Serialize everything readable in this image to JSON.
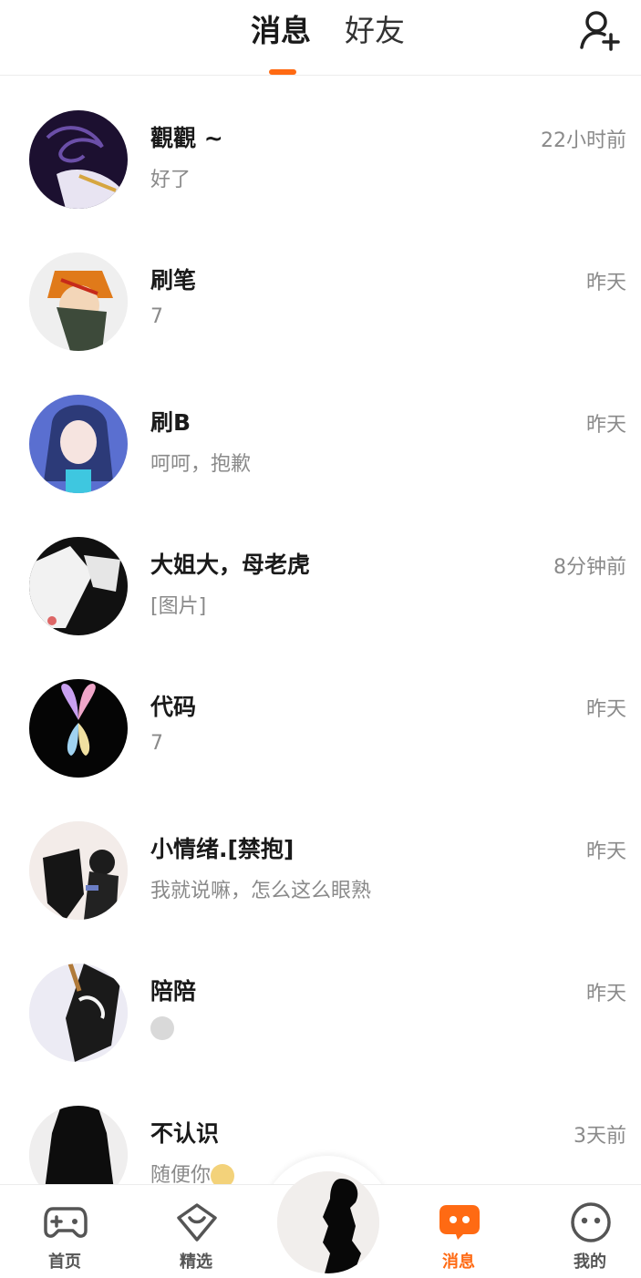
{
  "header": {
    "tabs": [
      {
        "label": "消息",
        "active": true
      },
      {
        "label": "好友",
        "active": false
      }
    ],
    "add_friend_icon": "add-user-icon",
    "accent_color": "#ff6a13"
  },
  "conversations": [
    {
      "name": "觀觀 ~",
      "preview": "好了",
      "time": "22小时前"
    },
    {
      "name": "刷笔",
      "preview": "7",
      "time": "昨天"
    },
    {
      "name": "刷B",
      "preview": "呵呵，抱歉",
      "time": "昨天"
    },
    {
      "name": "大姐大，母老虎",
      "preview": "[图片]",
      "time": "8分钟前"
    },
    {
      "name": "代码",
      "preview": "7",
      "time": "昨天"
    },
    {
      "name": "小情绪.[禁抱]",
      "preview": "我就说嘛，怎么这么眼熟",
      "time": "昨天"
    },
    {
      "name": "陪陪",
      "preview": "",
      "preview_emoji": "smirk-emoji",
      "time": "昨天"
    },
    {
      "name": "不认识",
      "preview": "随便你",
      "preview_emoji": "sad-emoji",
      "time": "3天前"
    }
  ],
  "bottom_nav": {
    "items": [
      {
        "label": "首页",
        "icon": "gamepad-icon",
        "active": false
      },
      {
        "label": "精选",
        "icon": "heart-badge-icon",
        "active": false
      },
      {
        "label": "消息",
        "icon": "chat-bubble-icon",
        "active": true
      },
      {
        "label": "我的",
        "icon": "face-icon",
        "active": false
      }
    ],
    "center_avatar": "user-avatar"
  }
}
